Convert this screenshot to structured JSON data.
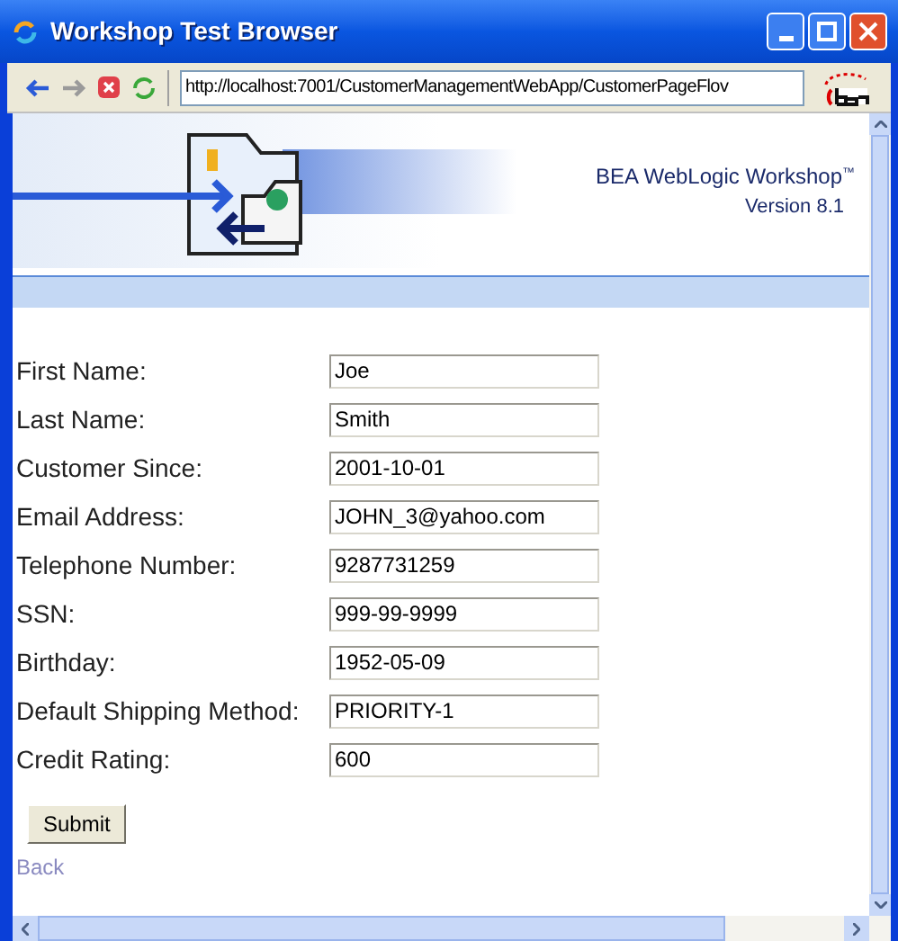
{
  "window": {
    "title": "Workshop Test Browser"
  },
  "toolbar": {
    "address": "http://localhost:7001/CustomerManagementWebApp/CustomerPageFlov"
  },
  "header": {
    "product": "BEA WebLogic Workshop",
    "trademark": "™",
    "version": "Version 8.1"
  },
  "form": {
    "fields": [
      {
        "label": "First Name:",
        "value": "Joe"
      },
      {
        "label": "Last Name:",
        "value": "Smith"
      },
      {
        "label": "Customer Since:",
        "value": "2001-10-01"
      },
      {
        "label": "Email Address:",
        "value": "JOHN_3@yahoo.com"
      },
      {
        "label": "Telephone Number:",
        "value": "9287731259"
      },
      {
        "label": "SSN:",
        "value": "999-99-9999"
      },
      {
        "label": "Birthday:",
        "value": "1952-05-09"
      },
      {
        "label": "Default Shipping Method:",
        "value": "PRIORITY-1"
      },
      {
        "label": "Credit Rating:",
        "value": "600"
      }
    ],
    "submit": "Submit"
  },
  "link": "Back"
}
